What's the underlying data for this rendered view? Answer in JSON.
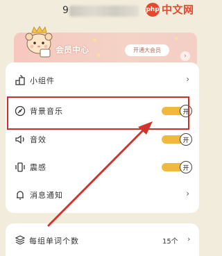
{
  "header": {
    "uid_prefix": "9",
    "watermark": {
      "logo": "php",
      "text": "中文网"
    }
  },
  "vip": {
    "title": "会员中心",
    "open_button": "开通大会员",
    "arrow": "›"
  },
  "settings": {
    "items": [
      {
        "label": "小组件",
        "icon": "widget-icon",
        "control": "chevron",
        "chevron": "›"
      },
      {
        "label": "背景音乐",
        "icon": "music-disc-icon",
        "control": "toggle",
        "toggle_text": "开",
        "on": true
      },
      {
        "label": "音效",
        "icon": "speaker-icon",
        "control": "toggle",
        "toggle_text": "开",
        "on": true
      },
      {
        "label": "震感",
        "icon": "vibration-icon",
        "control": "toggle",
        "toggle_text": "开",
        "on": true
      },
      {
        "label": "消息通知",
        "icon": "bell-icon",
        "control": "chevron",
        "chevron": "›"
      }
    ]
  },
  "bottom": {
    "label": "每组单词个数",
    "value": "15个",
    "chevron": "›"
  },
  "colors": {
    "background": "#f1ecdb",
    "toggle_on": "#f1b83c",
    "highlight": "#c9302c",
    "watermark": "#e8462d"
  }
}
